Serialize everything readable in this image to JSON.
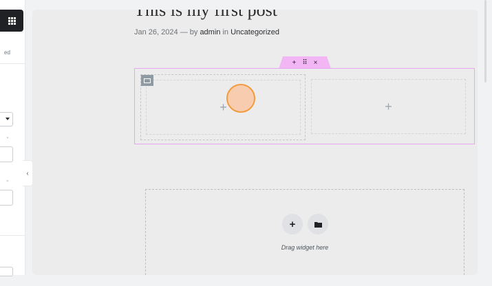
{
  "sidebar": {
    "partial_label": "ed",
    "widgets_icon": "grid-icon",
    "collapse_icon": "chevron-left-icon"
  },
  "post": {
    "title": "This is my first post",
    "date": "Jan 26, 2024",
    "separator": "—",
    "by_text": "by",
    "author": "admin",
    "in_text": "in",
    "category": "Uncategorized"
  },
  "section_handle": {
    "add": "+",
    "drag": "⠿",
    "close": "×"
  },
  "columns": [
    {
      "add_label": "+"
    },
    {
      "add_label": "+"
    }
  ],
  "dropzone": {
    "add_label": "+",
    "folder_icon": "folder-icon",
    "text": "Drag widget here"
  },
  "colors": {
    "section_border": "#e7a6ef",
    "section_handle": "#f2b6f5",
    "cursor_fill": "#fac8a5",
    "cursor_ring": "#f29a3e"
  }
}
